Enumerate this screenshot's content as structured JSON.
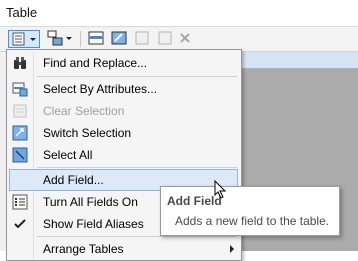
{
  "window": {
    "title": "Table"
  },
  "menu": {
    "items": [
      {
        "label": "Find and Replace...",
        "icon": "binoculars-icon",
        "enabled": true
      },
      {
        "label": "Select By Attributes...",
        "icon": "select-by-attributes-icon",
        "enabled": true
      },
      {
        "label": "Clear Selection",
        "icon": "clear-selection-icon",
        "enabled": false
      },
      {
        "label": "Switch Selection",
        "icon": "switch-selection-icon",
        "enabled": true
      },
      {
        "label": "Select All",
        "icon": "select-all-icon",
        "enabled": true
      },
      {
        "label": "Add Field...",
        "icon": "",
        "enabled": true,
        "hovered": true
      },
      {
        "label": "Turn All Fields On",
        "icon": "fields-list-icon",
        "enabled": true
      },
      {
        "label": "Show Field Aliases",
        "icon": "checkmark-icon",
        "enabled": true,
        "checked": true
      },
      {
        "label": "Arrange Tables",
        "icon": "",
        "enabled": true,
        "submenu": true
      }
    ]
  },
  "tooltip": {
    "title": "Add Field",
    "body": "Adds a new field to the table."
  },
  "colors": {
    "menu_bg": "#f5f5f5",
    "hover_bg": "#dde9f6",
    "hover_border": "#8cb6e4",
    "disabled_text": "#a0a0a0",
    "grid_bg": "#ababab"
  }
}
